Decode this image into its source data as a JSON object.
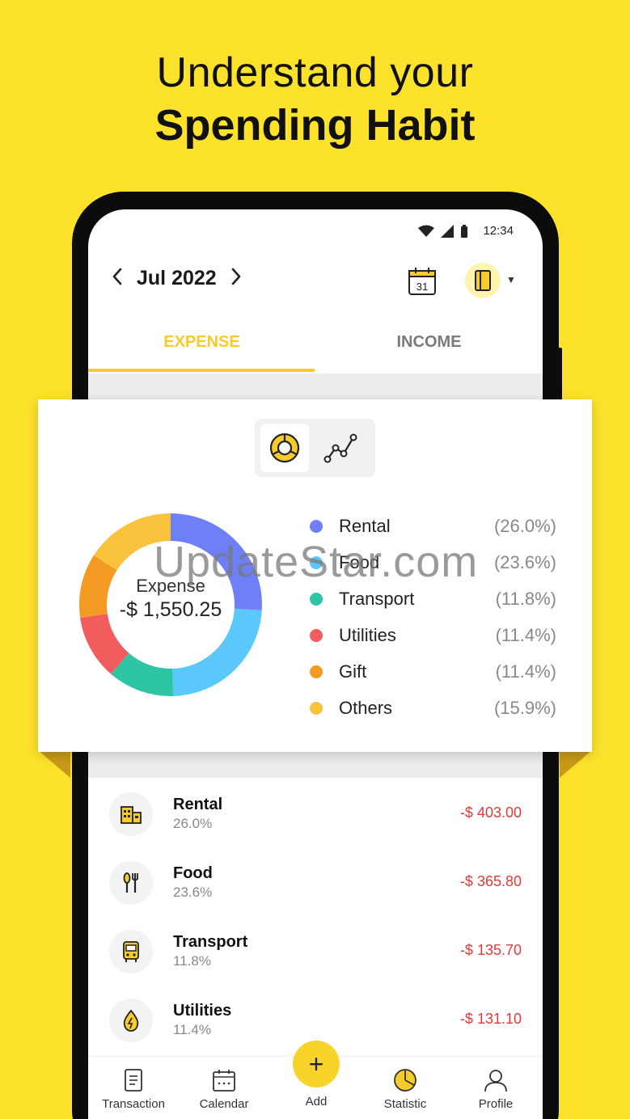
{
  "headline": {
    "line1": "Understand your",
    "line2": "Spending Habit"
  },
  "status": {
    "time": "12:34"
  },
  "header": {
    "month": "Jul 2022",
    "calendar_day": "31"
  },
  "tabs": [
    {
      "label": "EXPENSE",
      "active": true
    },
    {
      "label": "INCOME",
      "active": false
    }
  ],
  "summary": {
    "label": "Expense",
    "amount": "-$ 1,550.25"
  },
  "chart_data": {
    "type": "pie",
    "categories": [
      "Rental",
      "Food",
      "Transport",
      "Utilities",
      "Gift",
      "Others"
    ],
    "values": [
      26.0,
      23.6,
      11.8,
      11.4,
      11.4,
      15.9
    ],
    "colors": [
      "#6E7FF7",
      "#5AC8FA",
      "#2DC5A6",
      "#F25C5C",
      "#F59A23",
      "#FBC23D"
    ],
    "legend": [
      {
        "name": "Rental",
        "pct": "(26.0%)"
      },
      {
        "name": "Food",
        "pct": "(23.6%)"
      },
      {
        "name": "Transport",
        "pct": "(11.8%)"
      },
      {
        "name": "Utilities",
        "pct": "(11.4%)"
      },
      {
        "name": "Gift",
        "pct": "(11.4%)"
      },
      {
        "name": "Others",
        "pct": "(15.9%)"
      }
    ]
  },
  "watermark": "UpdateStar.com",
  "list": [
    {
      "name": "Rental",
      "pct": "26.0%",
      "amount": "-$ 403.00",
      "icon": "building-icon"
    },
    {
      "name": "Food",
      "pct": "23.6%",
      "amount": "-$ 365.80",
      "icon": "cutlery-icon"
    },
    {
      "name": "Transport",
      "pct": "11.8%",
      "amount": "-$ 135.70",
      "icon": "bus-icon"
    },
    {
      "name": "Utilities",
      "pct": "11.4%",
      "amount": "-$ 131.10",
      "icon": "water-drop-icon"
    }
  ],
  "nav": {
    "transaction": "Transaction",
    "calendar": "Calendar",
    "add": "Add",
    "statistic": "Statistic",
    "profile": "Profile"
  }
}
